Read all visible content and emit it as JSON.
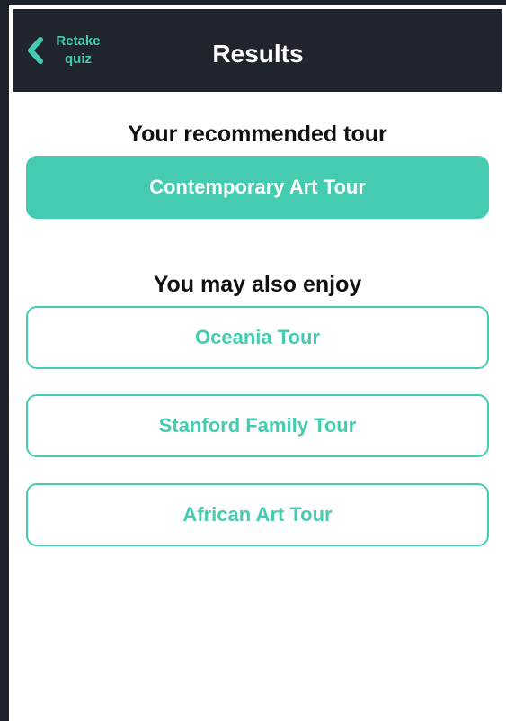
{
  "header": {
    "back_label": "Retake\nquiz",
    "title": "Results"
  },
  "recommended": {
    "heading": "Your recommended tour",
    "tour": "Contemporary Art Tour"
  },
  "also_enjoy": {
    "heading": "You may also enjoy",
    "tours": [
      "Oceania Tour",
      "Stanford Family Tour",
      "African Art Tour"
    ]
  },
  "colors": {
    "accent": "#45cbb0",
    "header_bg": "#20242d",
    "background": "#ffffff"
  },
  "icons": {
    "back": "chevron-left-icon"
  }
}
